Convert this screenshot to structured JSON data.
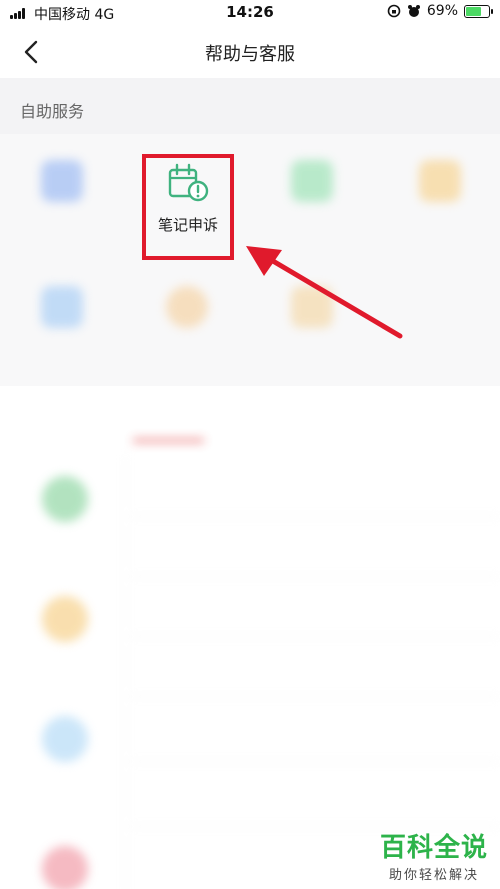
{
  "status_bar": {
    "carrier": "中国移动  4G",
    "time": "14:26",
    "battery_text": "69%",
    "battery_level": 0.69
  },
  "nav": {
    "title": "帮助与客服"
  },
  "section": {
    "title": "自助服务"
  },
  "highlighted_service": {
    "label": "笔记申诉",
    "icon": "calendar-alert-icon",
    "color": "#3fb27f"
  },
  "blurred_services": [
    {
      "icon": "image-icon",
      "color": "#a9c3f4"
    },
    {
      "icon": "person-icon",
      "color": "#a9e6bf"
    },
    {
      "icon": "document-icon",
      "color": "#f7d9a0"
    },
    {
      "icon": "video-icon",
      "color": "#b4d4f6"
    },
    {
      "icon": "coin-icon",
      "color": "#f6d8b0"
    },
    {
      "icon": "bag-icon",
      "color": "#f5ddb4"
    }
  ],
  "lower": {
    "categories": [
      {
        "color": "#9fdcb0"
      },
      {
        "color": "#f8d79a"
      },
      {
        "color": "#bfe0f8"
      },
      {
        "color": "#f3a9b3"
      }
    ]
  },
  "annotation": {
    "arrow_color": "#e01a2c"
  },
  "watermark": {
    "title": "百科全说",
    "subtitle": "助你轻松解决"
  }
}
